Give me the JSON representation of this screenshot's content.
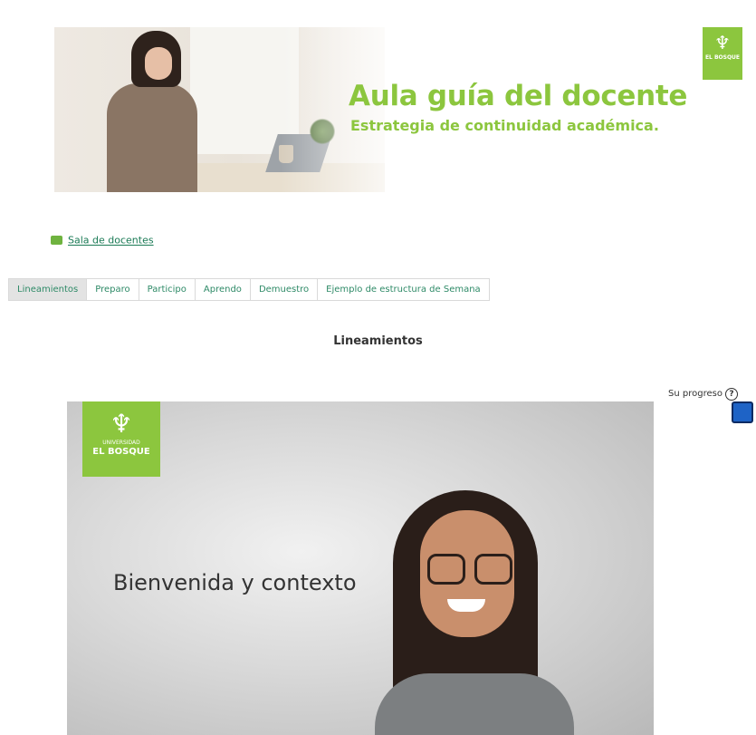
{
  "banner": {
    "title": "Aula guía del docente",
    "subtitle": "Estrategia de continuidad académica.",
    "logo_text": "EL BOSQUE"
  },
  "sala_link": {
    "label": "Sala de docentes",
    "icon": "forum-icon"
  },
  "tabs": [
    {
      "label": "Lineamientos",
      "active": true
    },
    {
      "label": "Preparo",
      "active": false
    },
    {
      "label": "Participo",
      "active": false
    },
    {
      "label": "Aprendo",
      "active": false
    },
    {
      "label": "Demuestro",
      "active": false
    },
    {
      "label": "Ejemplo de estructura de Semana",
      "active": false
    }
  ],
  "section_title": "Lineamientos",
  "progress": {
    "label": "Su progreso",
    "help_icon": "?"
  },
  "video": {
    "heading": "Bienvenida y contexto",
    "logo_top": "UNIVERSIDAD",
    "logo_bottom": "EL BOSQUE"
  },
  "colors": {
    "brand_green": "#8cc63e",
    "link_green": "#1a7a55",
    "tab_text": "#2e8a67",
    "progress_blue": "#1e63c6"
  }
}
